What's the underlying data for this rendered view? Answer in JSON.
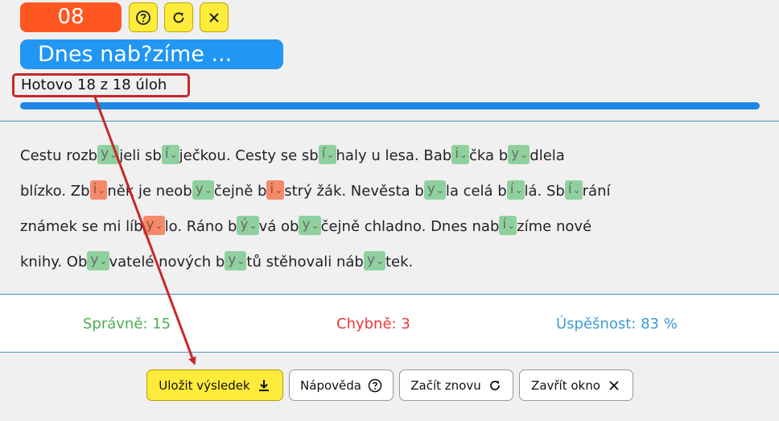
{
  "header": {
    "badge_number": "08",
    "title": "Dnes nab?zíme ...",
    "progress_text": "Hotovo 18 z 18 úloh",
    "progress": 1.0,
    "buttons": [
      {
        "name": "help-button",
        "icon": "question-circle-icon"
      },
      {
        "name": "restart-button",
        "icon": "refresh-icon"
      },
      {
        "name": "close-button",
        "icon": "close-icon"
      }
    ]
  },
  "exercise": {
    "lines": [
      [
        {
          "t": "text",
          "v": "Cestu rozb"
        },
        {
          "t": "blank",
          "v": "y",
          "status": "ok"
        },
        {
          "t": "text",
          "v": "jeli sb"
        },
        {
          "t": "blank",
          "v": "í",
          "status": "ok"
        },
        {
          "t": "text",
          "v": "ječkou. Cesty se sb"
        },
        {
          "t": "blank",
          "v": "í",
          "status": "ok"
        },
        {
          "t": "text",
          "v": "haly u lesa. Bab"
        },
        {
          "t": "blank",
          "v": "i",
          "status": "ok"
        },
        {
          "t": "text",
          "v": "čka b"
        },
        {
          "t": "blank",
          "v": "y",
          "status": "ok"
        },
        {
          "t": "text",
          "v": "dlela"
        }
      ],
      [
        {
          "t": "text",
          "v": "blízko. Zb"
        },
        {
          "t": "blank",
          "v": "i",
          "status": "bad"
        },
        {
          "t": "text",
          "v": "něk je neob"
        },
        {
          "t": "blank",
          "v": "y",
          "status": "ok"
        },
        {
          "t": "text",
          "v": "čejně b"
        },
        {
          "t": "blank",
          "v": "i",
          "status": "bad"
        },
        {
          "t": "text",
          "v": "strý žák. Nevěsta b"
        },
        {
          "t": "blank",
          "v": "y",
          "status": "ok"
        },
        {
          "t": "text",
          "v": "la celá b"
        },
        {
          "t": "blank",
          "v": "í",
          "status": "ok"
        },
        {
          "t": "text",
          "v": "lá. Sb"
        },
        {
          "t": "blank",
          "v": "í",
          "status": "ok"
        },
        {
          "t": "text",
          "v": "rání"
        }
      ],
      [
        {
          "t": "text",
          "v": "známek se mi líb"
        },
        {
          "t": "blank",
          "v": "y",
          "status": "bad"
        },
        {
          "t": "text",
          "v": "lo. Ráno b"
        },
        {
          "t": "blank",
          "v": "ý",
          "status": "ok"
        },
        {
          "t": "text",
          "v": "vá ob"
        },
        {
          "t": "blank",
          "v": "y",
          "status": "ok"
        },
        {
          "t": "text",
          "v": "čejně chladno. Dnes nab"
        },
        {
          "t": "blank",
          "v": "í",
          "status": "ok"
        },
        {
          "t": "text",
          "v": "zíme nové"
        }
      ],
      [
        {
          "t": "text",
          "v": "knihy. Ob"
        },
        {
          "t": "blank",
          "v": "y",
          "status": "ok"
        },
        {
          "t": "text",
          "v": "vatelé nových b"
        },
        {
          "t": "blank",
          "v": "y",
          "status": "ok"
        },
        {
          "t": "text",
          "v": "tů stěhovali náb"
        },
        {
          "t": "blank",
          "v": "y",
          "status": "ok"
        },
        {
          "t": "text",
          "v": "tek."
        }
      ]
    ]
  },
  "stats": {
    "correct": "Správně: 15",
    "wrong": "Chybně: 3",
    "success": "Úspěšnost: 83 %"
  },
  "footer": {
    "save_label": "Uložit výsledek",
    "help_label": "Nápověda",
    "restart_label": "Začít znovu",
    "close_label": "Zavřít okno"
  },
  "colors": {
    "badge": "#ff5722",
    "title": "#2196f3",
    "progress_bar": "#1e88e5",
    "correct": "#4caf50",
    "wrong": "#e53935",
    "success": "#3d9ad6",
    "annotation": "#c62828"
  }
}
